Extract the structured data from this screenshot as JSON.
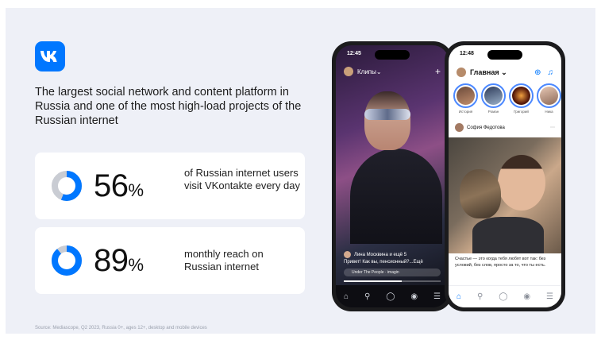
{
  "logo": {
    "text": "VK",
    "color": "#0077ff"
  },
  "headline": "The largest social network and content platform in Russia and one of the most high-load projects of the Russian internet",
  "stats": [
    {
      "value": "56",
      "unit": "%",
      "fraction": 0.56,
      "description": "of Russian internet users visit VKontakte every day"
    },
    {
      "value": "89",
      "unit": "%",
      "fraction": 0.89,
      "description": "monthly reach on Russian internet"
    }
  ],
  "source": "Source: Mediascope, Q2 2023, Russia 0+, ages 12+, desktop and mobile devices",
  "colors": {
    "accent": "#0077ff",
    "donut_track": "#c9ccd3",
    "background": "#eef0f7"
  },
  "phone_clips": {
    "time": "12:45",
    "title": "Клипы",
    "author": "Лина Москвина и ещё 5",
    "caption": "Привет! Как вы, пенсионный?...Ещё",
    "audio": "Under The People · imagin",
    "tabs": [
      "home-icon",
      "search-icon",
      "chat-icon",
      "clips-icon",
      "menu-icon"
    ]
  },
  "phone_main": {
    "time": "12:48",
    "title": "Главная",
    "stories": [
      {
        "name": "История"
      },
      {
        "name": "Роман"
      },
      {
        "name": "Григорий"
      },
      {
        "name": "Ника"
      }
    ],
    "post_author": "София Федотова",
    "post_text": "Счастье — это когда тебя любят вот так: без условий, без слов, просто за то, что ты есть.",
    "tabs": [
      "home-icon",
      "search-icon",
      "chat-icon",
      "clips-icon",
      "menu-icon"
    ]
  }
}
